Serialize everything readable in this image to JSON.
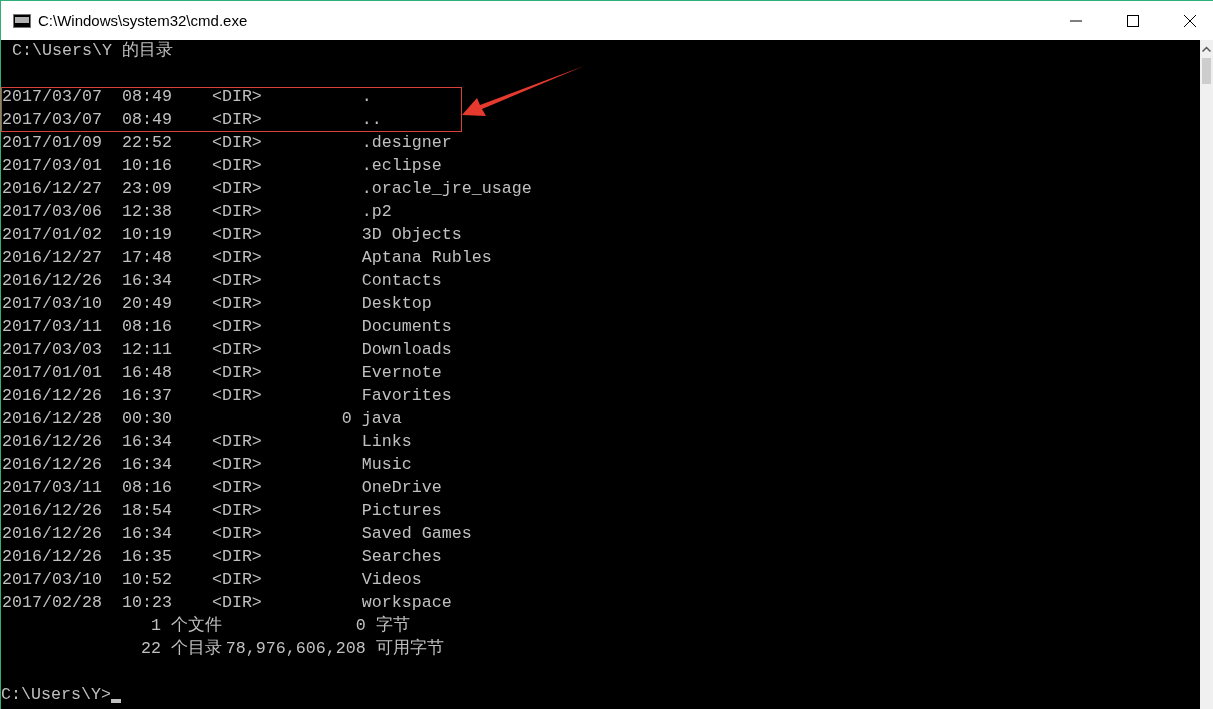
{
  "window": {
    "title": "C:\\Windows\\system32\\cmd.exe"
  },
  "console": {
    "heading": "C:\\Users\\Y 的目录",
    "rows": [
      {
        "date": "2017/03/07",
        "time": "08:49",
        "kind": "dir",
        "dir_label": "<DIR>",
        "name": "."
      },
      {
        "date": "2017/03/07",
        "time": "08:49",
        "kind": "dir",
        "dir_label": "<DIR>",
        "name": ".."
      },
      {
        "date": "2017/01/09",
        "time": "22:52",
        "kind": "dir",
        "dir_label": "<DIR>",
        "name": ".designer"
      },
      {
        "date": "2017/03/01",
        "time": "10:16",
        "kind": "dir",
        "dir_label": "<DIR>",
        "name": ".eclipse"
      },
      {
        "date": "2016/12/27",
        "time": "23:09",
        "kind": "dir",
        "dir_label": "<DIR>",
        "name": ".oracle_jre_usage"
      },
      {
        "date": "2017/03/06",
        "time": "12:38",
        "kind": "dir",
        "dir_label": "<DIR>",
        "name": ".p2"
      },
      {
        "date": "2017/01/02",
        "time": "10:19",
        "kind": "dir",
        "dir_label": "<DIR>",
        "name": "3D Objects"
      },
      {
        "date": "2016/12/27",
        "time": "17:48",
        "kind": "dir",
        "dir_label": "<DIR>",
        "name": "Aptana Rubles"
      },
      {
        "date": "2016/12/26",
        "time": "16:34",
        "kind": "dir",
        "dir_label": "<DIR>",
        "name": "Contacts"
      },
      {
        "date": "2017/03/10",
        "time": "20:49",
        "kind": "dir",
        "dir_label": "<DIR>",
        "name": "Desktop"
      },
      {
        "date": "2017/03/11",
        "time": "08:16",
        "kind": "dir",
        "dir_label": "<DIR>",
        "name": "Documents"
      },
      {
        "date": "2017/03/03",
        "time": "12:11",
        "kind": "dir",
        "dir_label": "<DIR>",
        "name": "Downloads"
      },
      {
        "date": "2017/01/01",
        "time": "16:48",
        "kind": "dir",
        "dir_label": "<DIR>",
        "name": "Evernote"
      },
      {
        "date": "2016/12/26",
        "time": "16:37",
        "kind": "dir",
        "dir_label": "<DIR>",
        "name": "Favorites"
      },
      {
        "date": "2016/12/28",
        "time": "00:30",
        "kind": "file",
        "size": "0",
        "name": "java"
      },
      {
        "date": "2016/12/26",
        "time": "16:34",
        "kind": "dir",
        "dir_label": "<DIR>",
        "name": "Links"
      },
      {
        "date": "2016/12/26",
        "time": "16:34",
        "kind": "dir",
        "dir_label": "<DIR>",
        "name": "Music"
      },
      {
        "date": "2017/03/11",
        "time": "08:16",
        "kind": "dir",
        "dir_label": "<DIR>",
        "name": "OneDrive"
      },
      {
        "date": "2016/12/26",
        "time": "18:54",
        "kind": "dir",
        "dir_label": "<DIR>",
        "name": "Pictures"
      },
      {
        "date": "2016/12/26",
        "time": "16:34",
        "kind": "dir",
        "dir_label": "<DIR>",
        "name": "Saved Games"
      },
      {
        "date": "2016/12/26",
        "time": "16:35",
        "kind": "dir",
        "dir_label": "<DIR>",
        "name": "Searches"
      },
      {
        "date": "2017/03/10",
        "time": "10:52",
        "kind": "dir",
        "dir_label": "<DIR>",
        "name": "Videos"
      },
      {
        "date": "2017/02/28",
        "time": "10:23",
        "kind": "dir",
        "dir_label": "<DIR>",
        "name": "workspace"
      }
    ],
    "summary": [
      {
        "count": "1",
        "label": "个文件",
        "amount": "0",
        "unit": "字节"
      },
      {
        "count": "22",
        "label": "个目录",
        "amount": "78,976,606,208",
        "unit": "可用字节"
      }
    ],
    "prompt": "C:\\Users\\Y>"
  }
}
